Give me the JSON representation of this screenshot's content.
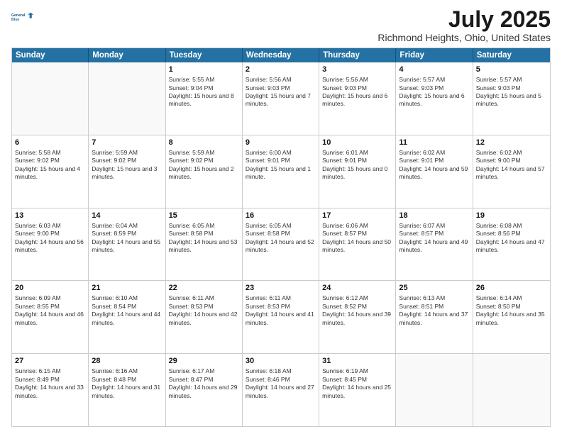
{
  "header": {
    "logo_line1": "General",
    "logo_line2": "Blue",
    "title": "July 2025",
    "subtitle": "Richmond Heights, Ohio, United States"
  },
  "days_of_week": [
    "Sunday",
    "Monday",
    "Tuesday",
    "Wednesday",
    "Thursday",
    "Friday",
    "Saturday"
  ],
  "weeks": [
    [
      {
        "day": "",
        "empty": true
      },
      {
        "day": "",
        "empty": true
      },
      {
        "day": "1",
        "sunrise": "5:55 AM",
        "sunset": "9:04 PM",
        "daylight": "15 hours and 8 minutes."
      },
      {
        "day": "2",
        "sunrise": "5:56 AM",
        "sunset": "9:03 PM",
        "daylight": "15 hours and 7 minutes."
      },
      {
        "day": "3",
        "sunrise": "5:56 AM",
        "sunset": "9:03 PM",
        "daylight": "15 hours and 6 minutes."
      },
      {
        "day": "4",
        "sunrise": "5:57 AM",
        "sunset": "9:03 PM",
        "daylight": "15 hours and 6 minutes."
      },
      {
        "day": "5",
        "sunrise": "5:57 AM",
        "sunset": "9:03 PM",
        "daylight": "15 hours and 5 minutes."
      }
    ],
    [
      {
        "day": "6",
        "sunrise": "5:58 AM",
        "sunset": "9:02 PM",
        "daylight": "15 hours and 4 minutes."
      },
      {
        "day": "7",
        "sunrise": "5:59 AM",
        "sunset": "9:02 PM",
        "daylight": "15 hours and 3 minutes."
      },
      {
        "day": "8",
        "sunrise": "5:59 AM",
        "sunset": "9:02 PM",
        "daylight": "15 hours and 2 minutes."
      },
      {
        "day": "9",
        "sunrise": "6:00 AM",
        "sunset": "9:01 PM",
        "daylight": "15 hours and 1 minute."
      },
      {
        "day": "10",
        "sunrise": "6:01 AM",
        "sunset": "9:01 PM",
        "daylight": "15 hours and 0 minutes."
      },
      {
        "day": "11",
        "sunrise": "6:02 AM",
        "sunset": "9:01 PM",
        "daylight": "14 hours and 59 minutes."
      },
      {
        "day": "12",
        "sunrise": "6:02 AM",
        "sunset": "9:00 PM",
        "daylight": "14 hours and 57 minutes."
      }
    ],
    [
      {
        "day": "13",
        "sunrise": "6:03 AM",
        "sunset": "9:00 PM",
        "daylight": "14 hours and 56 minutes."
      },
      {
        "day": "14",
        "sunrise": "6:04 AM",
        "sunset": "8:59 PM",
        "daylight": "14 hours and 55 minutes."
      },
      {
        "day": "15",
        "sunrise": "6:05 AM",
        "sunset": "8:58 PM",
        "daylight": "14 hours and 53 minutes."
      },
      {
        "day": "16",
        "sunrise": "6:05 AM",
        "sunset": "8:58 PM",
        "daylight": "14 hours and 52 minutes."
      },
      {
        "day": "17",
        "sunrise": "6:06 AM",
        "sunset": "8:57 PM",
        "daylight": "14 hours and 50 minutes."
      },
      {
        "day": "18",
        "sunrise": "6:07 AM",
        "sunset": "8:57 PM",
        "daylight": "14 hours and 49 minutes."
      },
      {
        "day": "19",
        "sunrise": "6:08 AM",
        "sunset": "8:56 PM",
        "daylight": "14 hours and 47 minutes."
      }
    ],
    [
      {
        "day": "20",
        "sunrise": "6:09 AM",
        "sunset": "8:55 PM",
        "daylight": "14 hours and 46 minutes."
      },
      {
        "day": "21",
        "sunrise": "6:10 AM",
        "sunset": "8:54 PM",
        "daylight": "14 hours and 44 minutes."
      },
      {
        "day": "22",
        "sunrise": "6:11 AM",
        "sunset": "8:53 PM",
        "daylight": "14 hours and 42 minutes."
      },
      {
        "day": "23",
        "sunrise": "6:11 AM",
        "sunset": "8:53 PM",
        "daylight": "14 hours and 41 minutes."
      },
      {
        "day": "24",
        "sunrise": "6:12 AM",
        "sunset": "8:52 PM",
        "daylight": "14 hours and 39 minutes."
      },
      {
        "day": "25",
        "sunrise": "6:13 AM",
        "sunset": "8:51 PM",
        "daylight": "14 hours and 37 minutes."
      },
      {
        "day": "26",
        "sunrise": "6:14 AM",
        "sunset": "8:50 PM",
        "daylight": "14 hours and 35 minutes."
      }
    ],
    [
      {
        "day": "27",
        "sunrise": "6:15 AM",
        "sunset": "8:49 PM",
        "daylight": "14 hours and 33 minutes."
      },
      {
        "day": "28",
        "sunrise": "6:16 AM",
        "sunset": "8:48 PM",
        "daylight": "14 hours and 31 minutes."
      },
      {
        "day": "29",
        "sunrise": "6:17 AM",
        "sunset": "8:47 PM",
        "daylight": "14 hours and 29 minutes."
      },
      {
        "day": "30",
        "sunrise": "6:18 AM",
        "sunset": "8:46 PM",
        "daylight": "14 hours and 27 minutes."
      },
      {
        "day": "31",
        "sunrise": "6:19 AM",
        "sunset": "8:45 PM",
        "daylight": "14 hours and 25 minutes."
      },
      {
        "day": "",
        "empty": true
      },
      {
        "day": "",
        "empty": true
      }
    ]
  ]
}
